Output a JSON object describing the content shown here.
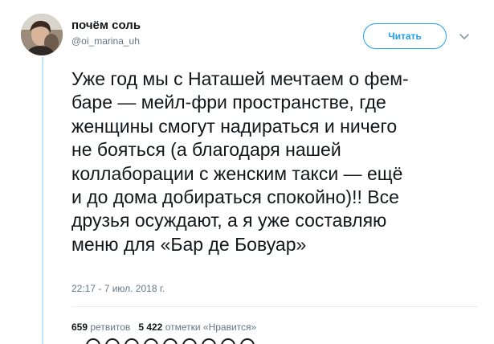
{
  "author": {
    "name": "почём соль",
    "handle": "@oi_marina_uh",
    "avatar_icon": "user-avatar"
  },
  "follow_button": {
    "label": "Читать"
  },
  "menu_icon": "chevron-down-icon",
  "tweet": {
    "text": "Уже год мы с Наташей мечтаем о фем-\nбаре — мейл-фри пространстве, где\nженщины смогут надираться и ничего\nне бояться (а благодаря нашей\nколлаборации с женским такси — ещё\nи до дома добираться спокойно)!! Все\nдрузья осуждают, а я уже составляю\nменю для «Бар де Бовуар»",
    "timestamp": "22:17 - 7 июл. 2018 г."
  },
  "stats": {
    "retweets": {
      "count": "659",
      "label": "ретвитов"
    },
    "likes": {
      "count": "5 422",
      "label": "отметки «Нравится»"
    }
  },
  "colors": {
    "accent": "#1da1f2",
    "text": "#14171a",
    "secondary": "#657786",
    "thread_line": "#c4e4fa"
  }
}
